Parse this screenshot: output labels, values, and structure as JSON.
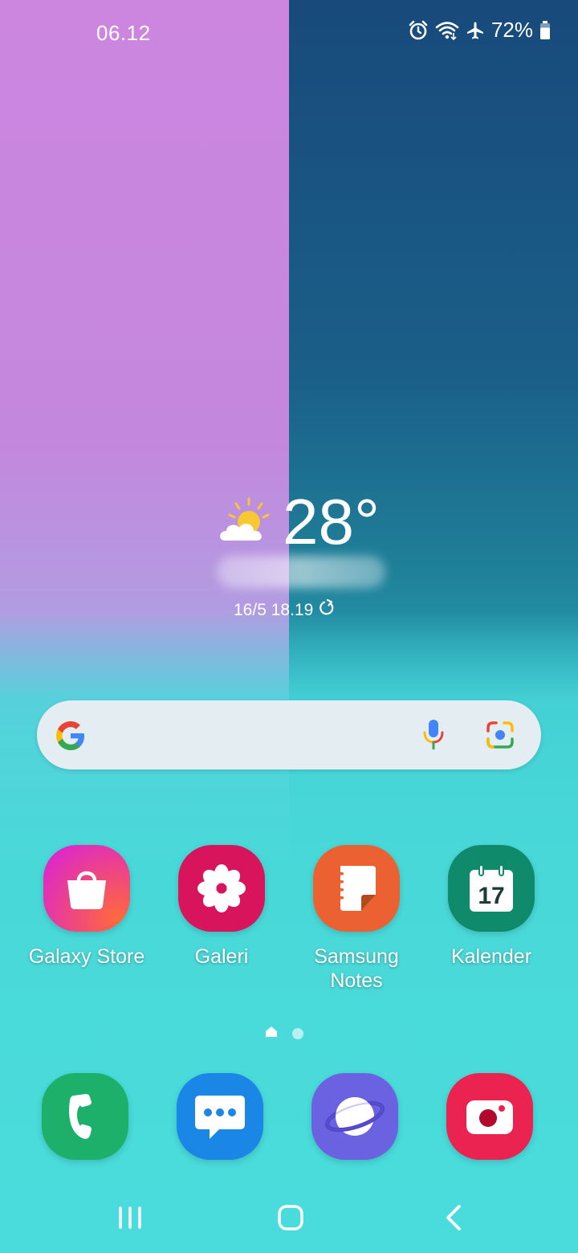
{
  "status_bar": {
    "time": "06.12",
    "battery_percent": "72%",
    "icons": [
      "alarm-icon",
      "wifi-icon",
      "airplane-mode-icon",
      "battery-icon"
    ]
  },
  "weather": {
    "temperature": "28°",
    "updated": "16/5 18.19",
    "icon": "partly-sunny-icon"
  },
  "search_bar": {
    "icons": [
      "google-logo-icon",
      "microphone-icon",
      "google-lens-icon"
    ]
  },
  "apps": [
    {
      "label": "Galaxy Store",
      "icon": "shopping-bag-icon",
      "color": "#e03a9a"
    },
    {
      "label": "Galeri",
      "icon": "flower-icon",
      "color": "#d8145c"
    },
    {
      "label": "Samsung\nNotes",
      "icon": "note-icon",
      "color": "#ec6131"
    },
    {
      "label": "Kalender",
      "icon": "calendar-icon",
      "color": "#0f8a6b",
      "day": "17"
    }
  ],
  "dock": [
    {
      "icon": "phone-icon",
      "color": "#1db06b"
    },
    {
      "icon": "messages-icon",
      "color": "#1a86e6"
    },
    {
      "icon": "internet-icon",
      "color": "#6a62e0"
    },
    {
      "icon": "camera-icon",
      "color": "#eb2350"
    }
  ],
  "page_indicator": {
    "pages": 2,
    "current": 1
  },
  "nav_bar": {
    "buttons": [
      "recents-button",
      "home-button",
      "back-button"
    ]
  }
}
